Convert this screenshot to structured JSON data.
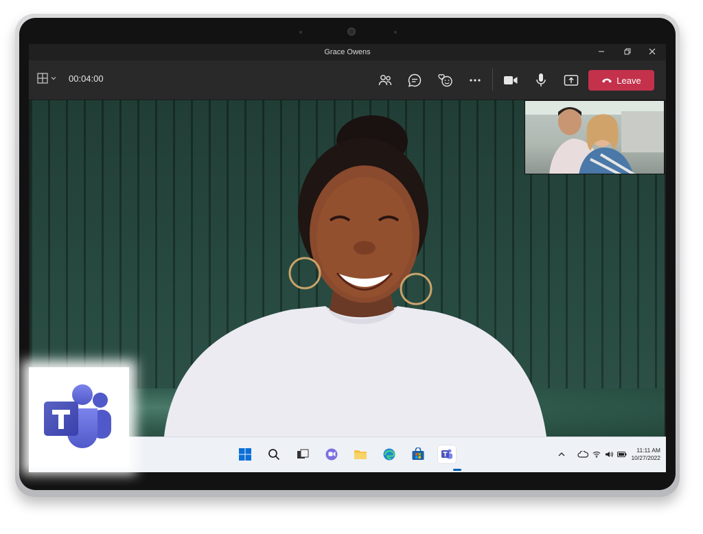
{
  "window": {
    "title": "Grace Owens"
  },
  "toolbar": {
    "view_menu": "layout-grid-icon",
    "timer": "00:04:00",
    "leave_label": "Leave"
  },
  "taskbar": {
    "items": [
      "windows-start-icon",
      "search-icon",
      "task-view-icon",
      "teams-chat-icon",
      "file-explorer-icon",
      "edge-icon",
      "store-icon",
      "teams-icon"
    ],
    "active": "teams-icon"
  },
  "system_tray": {
    "time": "11:11 AM",
    "date": "10/27/2022"
  },
  "colors": {
    "leave": "#c4314b",
    "teams_purple": "#5b5fc7",
    "chat_accent": "#8b8cd8"
  }
}
